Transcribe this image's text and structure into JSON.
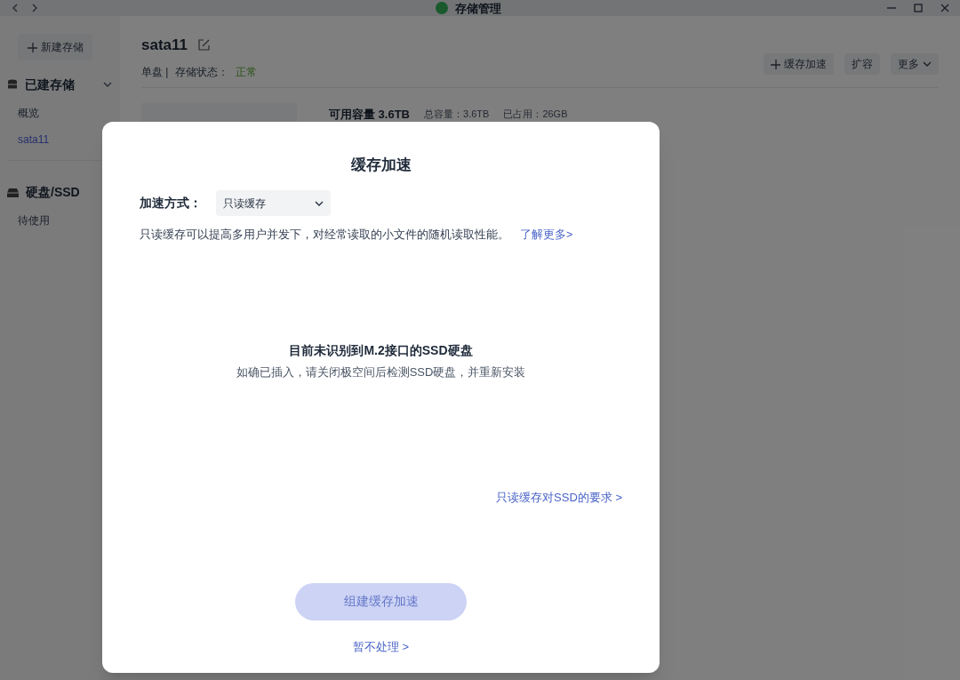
{
  "window": {
    "title": "存储管理"
  },
  "sidebar": {
    "new_button": "新建存储",
    "groups": [
      {
        "label": "已建存储",
        "kind": "database",
        "expanded": true,
        "items": [
          {
            "label": "概览",
            "selected": false
          },
          {
            "label": "sata11",
            "selected": true
          }
        ]
      },
      {
        "label": "硬盘/SSD",
        "kind": "disk",
        "items": [
          {
            "label": "待使用",
            "selected": false
          }
        ]
      }
    ]
  },
  "header": {
    "name": "sata11",
    "type": "单盘 |",
    "status_label": "存储状态：",
    "status": "正常",
    "actions": [
      {
        "label": "缓存加速",
        "kind": "add"
      },
      {
        "label": "扩容",
        "kind": "plain"
      },
      {
        "label": "更多",
        "kind": "menu"
      }
    ]
  },
  "stats": {
    "available": "可用容量 3.6TB",
    "total": "总容量：3.6TB",
    "used": "已占用：26GB"
  },
  "dialog": {
    "title": "缓存加速",
    "mode_label": "加速方式：",
    "mode_value": "只读缓存",
    "description": "只读缓存可以提高多用户并发下，对经常读取的小文件的随机读取性能。",
    "learn_more": "了解更多>",
    "empty_title": "目前未识别到M.2接口的SSD硬盘",
    "empty_hint": "如确已插入，请关闭极空间后检测SSD硬盘，并重新安装",
    "requirements_link": "只读缓存对SSD的要求 >",
    "primary": {
      "label": "组建缓存加速",
      "disabled": true
    },
    "skip_link": "暂不处理 >"
  }
}
